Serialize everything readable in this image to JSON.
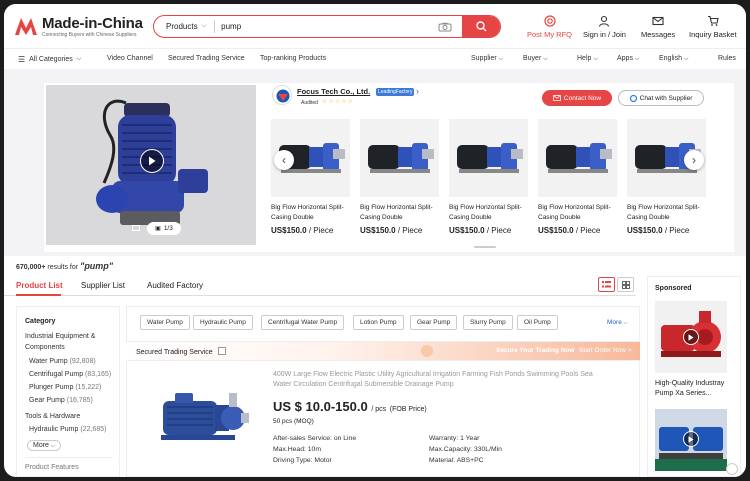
{
  "header": {
    "logo_name": "Made-in-China",
    "logo_tagline": "Connecting Buyers with Chinese Suppliers",
    "search": {
      "category": "Products",
      "value": "pump"
    },
    "icons": [
      {
        "label": "Post My RFQ",
        "icon": "rfq-icon",
        "color": "#e64545"
      },
      {
        "label": "Sign in / Join",
        "icon": "user-icon"
      },
      {
        "label": "Messages",
        "icon": "mail-icon"
      },
      {
        "label": "Inquiry Basket",
        "icon": "cart-icon"
      }
    ]
  },
  "nav": {
    "all_categories": "All Categories",
    "links": [
      "Video Channel",
      "Secured Trading Service",
      "Top-ranking Products"
    ],
    "right": [
      "Supplier",
      "Buyer",
      "Help",
      "Apps",
      "English",
      "Rules"
    ]
  },
  "featured": {
    "image_count": "1/3",
    "supplier": {
      "name": "Focus Tech Co., Ltd.",
      "badge": "LeadingFactory",
      "audited": "Audited",
      "stars": "☆☆☆☆☆"
    },
    "contact_label": "Contact Now",
    "chat_label": "Chat with Supplier",
    "products": [
      {
        "title": "Big Flow Horizontal Split-Casing Double",
        "price": "US$150.0",
        "unit": "/ Piece"
      },
      {
        "title": "Big Flow Horizontal Split-Casing Double",
        "price": "US$150.0",
        "unit": "/ Piece"
      },
      {
        "title": "Big Flow Horizontal Split-Casing Double",
        "price": "US$150.0",
        "unit": "/ Piece"
      },
      {
        "title": "Big Flow Horizontal Split-Casing Double",
        "price": "US$150.0",
        "unit": "/ Piece"
      },
      {
        "title": "Big Flow Horizontal Split-Casing Double",
        "price": "US$150.0",
        "unit": "/ Piece"
      }
    ]
  },
  "results": {
    "count": "670,000+",
    "text": "results for",
    "query": "\"pump\""
  },
  "tabs": [
    "Product List",
    "Supplier List",
    "Audited Factory"
  ],
  "sidebar": {
    "category_title": "Category",
    "group1": "Industrial Equipment &",
    "group1b": "Components",
    "items": [
      {
        "label": "Water Pump",
        "count": "(92,808)"
      },
      {
        "label": "Centrifugal Pump",
        "count": "(83,165)"
      },
      {
        "label": "Plunger Pump",
        "count": "(15,222)"
      },
      {
        "label": "Gear Pump",
        "count": "(16,785)"
      }
    ],
    "group2": "Tools & Hardware",
    "items2": [
      {
        "label": "Hydraulic Pump",
        "count": "(22,685)"
      }
    ],
    "more": "More",
    "features": "Product Features"
  },
  "filters": {
    "chips": [
      "Water Pump",
      "Hydraulic Pump",
      "Centrifugal Water Pump",
      "Lotion Pump",
      "Gear Pump",
      "Slurry Pump",
      "Oil Pump"
    ],
    "more": "More"
  },
  "trade_bar": {
    "label": "Secured Trading Service",
    "secure": "Secure Your Trading Now",
    "start": "Start Order Now >"
  },
  "result_item": {
    "title": "400W Large Flow Electric Plastic Utility Agricultural Irrigation Farming Fish Ponds Swimming Pools Sea Water Circulation Centrifugal Submersible Drainage Pump",
    "price": "US $ 10.0-150.0",
    "price_unit": "/ pcs",
    "price_type": "(FOB Price)",
    "moq": "50 pcs (MOQ)",
    "attrs_left": [
      "After-sales Service:   on Line",
      "Max.Head:   10m",
      "Driving Type:   Motor"
    ],
    "attrs_right": [
      "Warranty:   1 Year",
      "Max.Capacity:   330L/Min",
      "Material:   ABS+PC"
    ]
  },
  "sponsored": {
    "title": "Sponsored",
    "caption": "High-Quality Industray Pump Xa Series..."
  }
}
